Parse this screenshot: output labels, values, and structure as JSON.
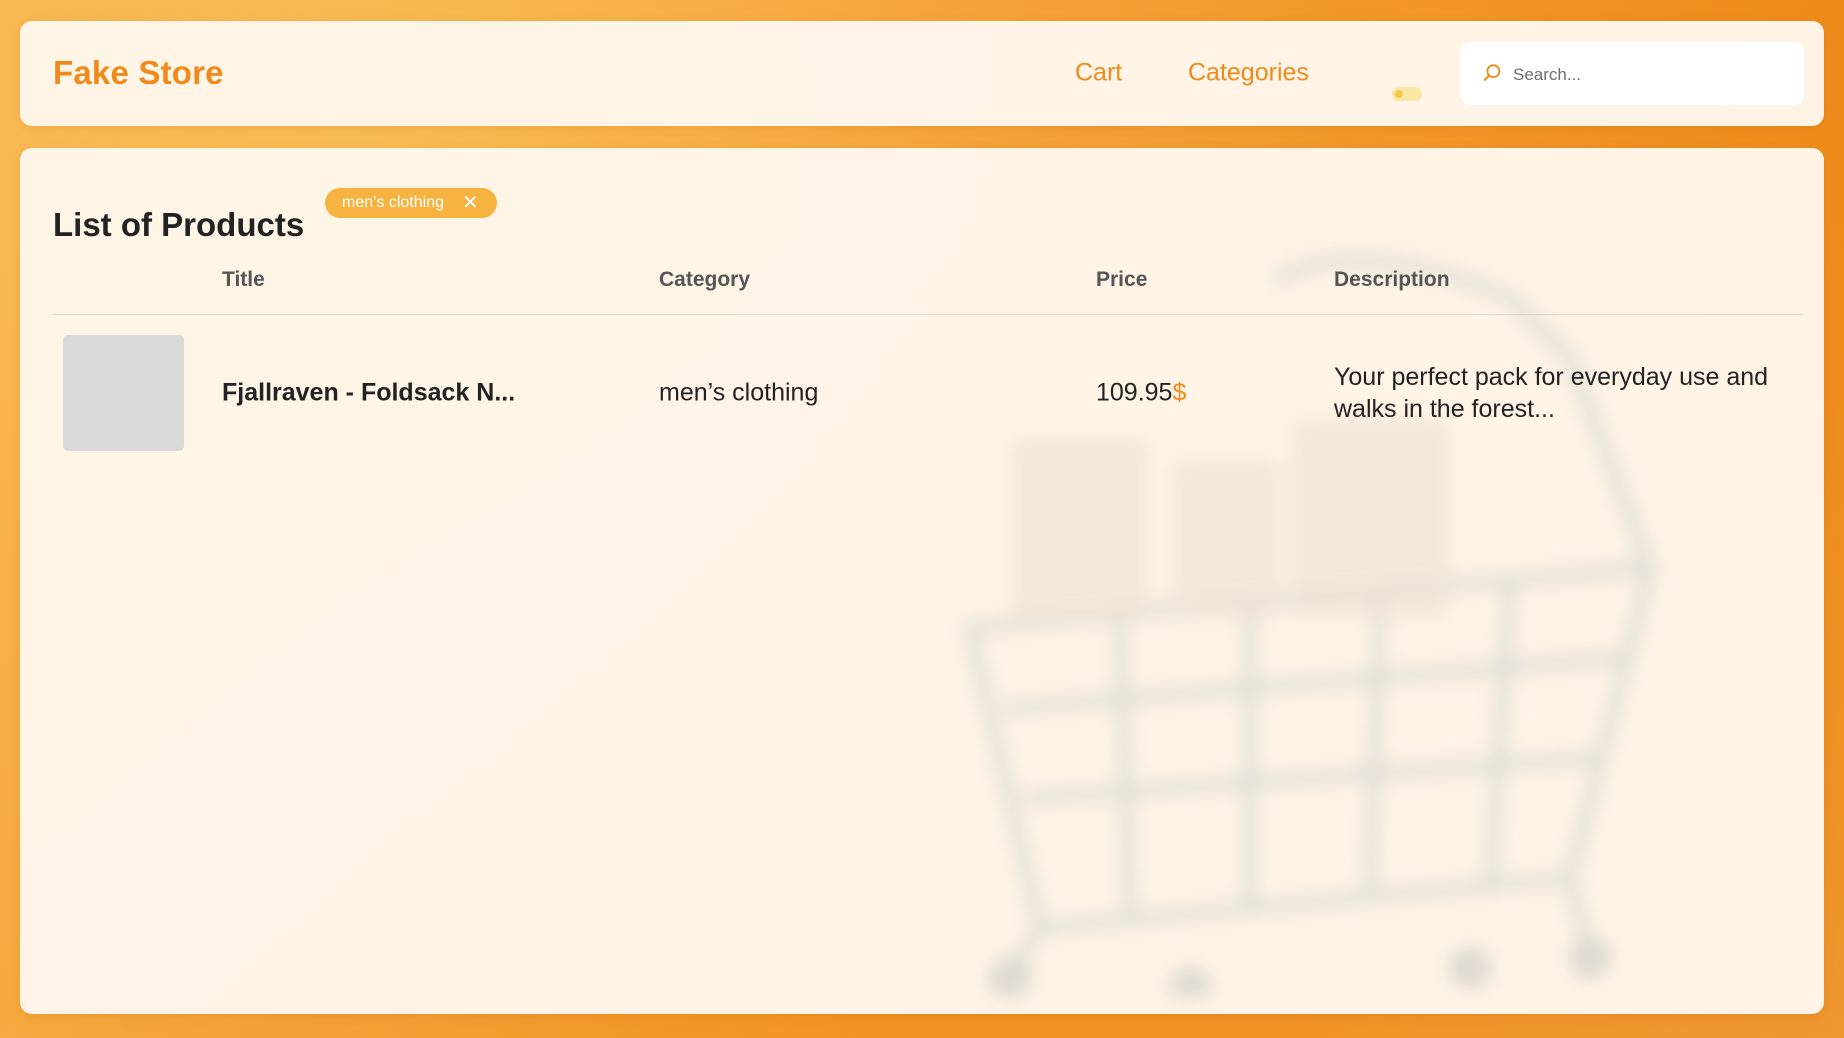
{
  "header": {
    "brand": "Fake Store",
    "nav": {
      "cart": "Cart",
      "categories": "Categories"
    },
    "search": {
      "placeholder": "Search..."
    }
  },
  "main": {
    "title": "List of Products",
    "filter_chip": {
      "label": "men’s clothing",
      "close": "✕"
    },
    "table": {
      "columns": {
        "title": "Title",
        "category": "Category",
        "price": "Price",
        "description": "Description"
      },
      "rows": [
        {
          "title": "Fjallraven - Foldsack N...",
          "category": "men’s clothing",
          "price": "109.95",
          "currency": "$",
          "description": "Your perfect pack for everyday use and walks in the forest..."
        }
      ]
    }
  },
  "theme": {
    "accent": "#f08a1b",
    "chip_color": "#f6b33f",
    "panel_background": "#fff7ec"
  },
  "icons": {
    "search": "search-icon",
    "theme_toggle": "toggle-icon",
    "chip_close": "close-icon"
  }
}
